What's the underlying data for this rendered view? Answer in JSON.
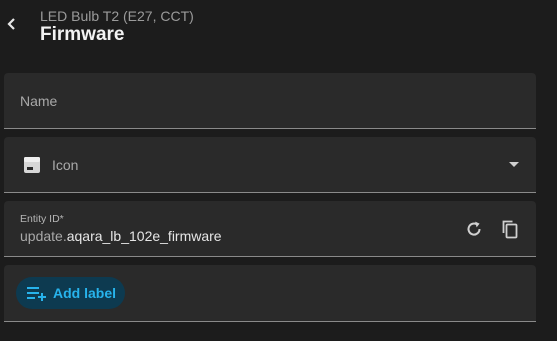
{
  "header": {
    "subtitle": "LED Bulb T2 (E27, CCT)",
    "title": "Firmware",
    "back_icon": "chevron-left-icon"
  },
  "name_field": {
    "label": "Name"
  },
  "icon_field": {
    "label": "Icon",
    "preview_icon": "package-box-icon",
    "dropdown_icon": "arrow-drop-down-icon"
  },
  "entity_field": {
    "caption": "Entity ID*",
    "prefix": "update.",
    "value": "aqara_lb_102e_firmware",
    "reset_icon": "restore-icon",
    "copy_icon": "copy-icon"
  },
  "labels": {
    "add_label": "Add label",
    "add_icon": "playlist-add-icon"
  },
  "colors": {
    "background": "#1c1c1c",
    "field": "#2a2a2a",
    "accent": "#27b3ec",
    "chip": "#0d3a50"
  }
}
